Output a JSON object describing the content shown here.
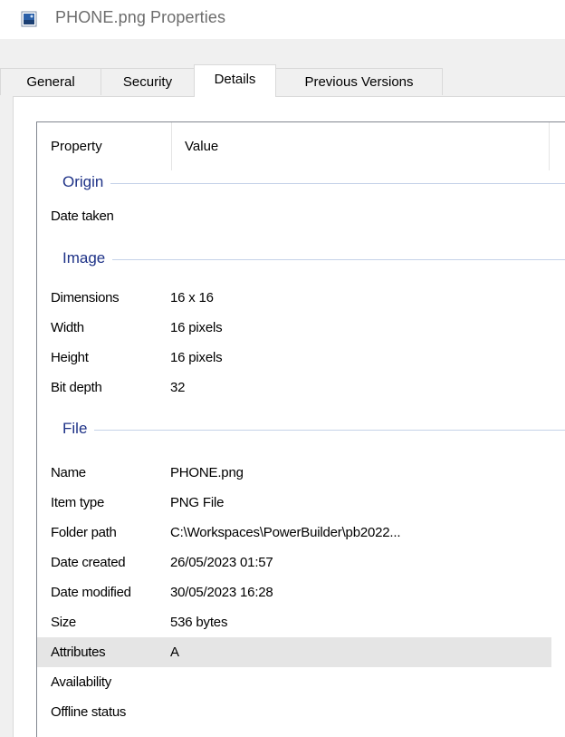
{
  "window": {
    "title": "PHONE.png Properties",
    "icon": "image-file-icon"
  },
  "tabs": [
    {
      "label": "General",
      "active": false
    },
    {
      "label": "Security",
      "active": false
    },
    {
      "label": "Details",
      "active": true
    },
    {
      "label": "Previous Versions",
      "active": false
    }
  ],
  "details": {
    "columns": {
      "property": "Property",
      "value": "Value"
    },
    "groups": {
      "origin": "Origin",
      "image": "Image",
      "file": "File"
    },
    "rows": {
      "date_taken": {
        "property": "Date taken",
        "value": ""
      },
      "dimensions": {
        "property": "Dimensions",
        "value": "16 x 16"
      },
      "width": {
        "property": "Width",
        "value": "16 pixels"
      },
      "height": {
        "property": "Height",
        "value": "16 pixels"
      },
      "bit_depth": {
        "property": "Bit depth",
        "value": "32"
      },
      "name": {
        "property": "Name",
        "value": "PHONE.png"
      },
      "item_type": {
        "property": "Item type",
        "value": "PNG File"
      },
      "folder_path": {
        "property": "Folder path",
        "value": "C:\\Workspaces\\PowerBuilder\\pb2022..."
      },
      "date_created": {
        "property": "Date created",
        "value": "26/05/2023 01:57"
      },
      "date_modified": {
        "property": "Date modified",
        "value": "30/05/2023 16:28"
      },
      "size": {
        "property": "Size",
        "value": "536 bytes"
      },
      "attributes": {
        "property": "Attributes",
        "value": "A"
      },
      "availability": {
        "property": "Availability",
        "value": ""
      },
      "offline_status": {
        "property": "Offline status",
        "value": ""
      }
    },
    "selected_row": "attributes"
  },
  "colors": {
    "group_label": "#1e3287",
    "selection": "#e5e5e5"
  }
}
